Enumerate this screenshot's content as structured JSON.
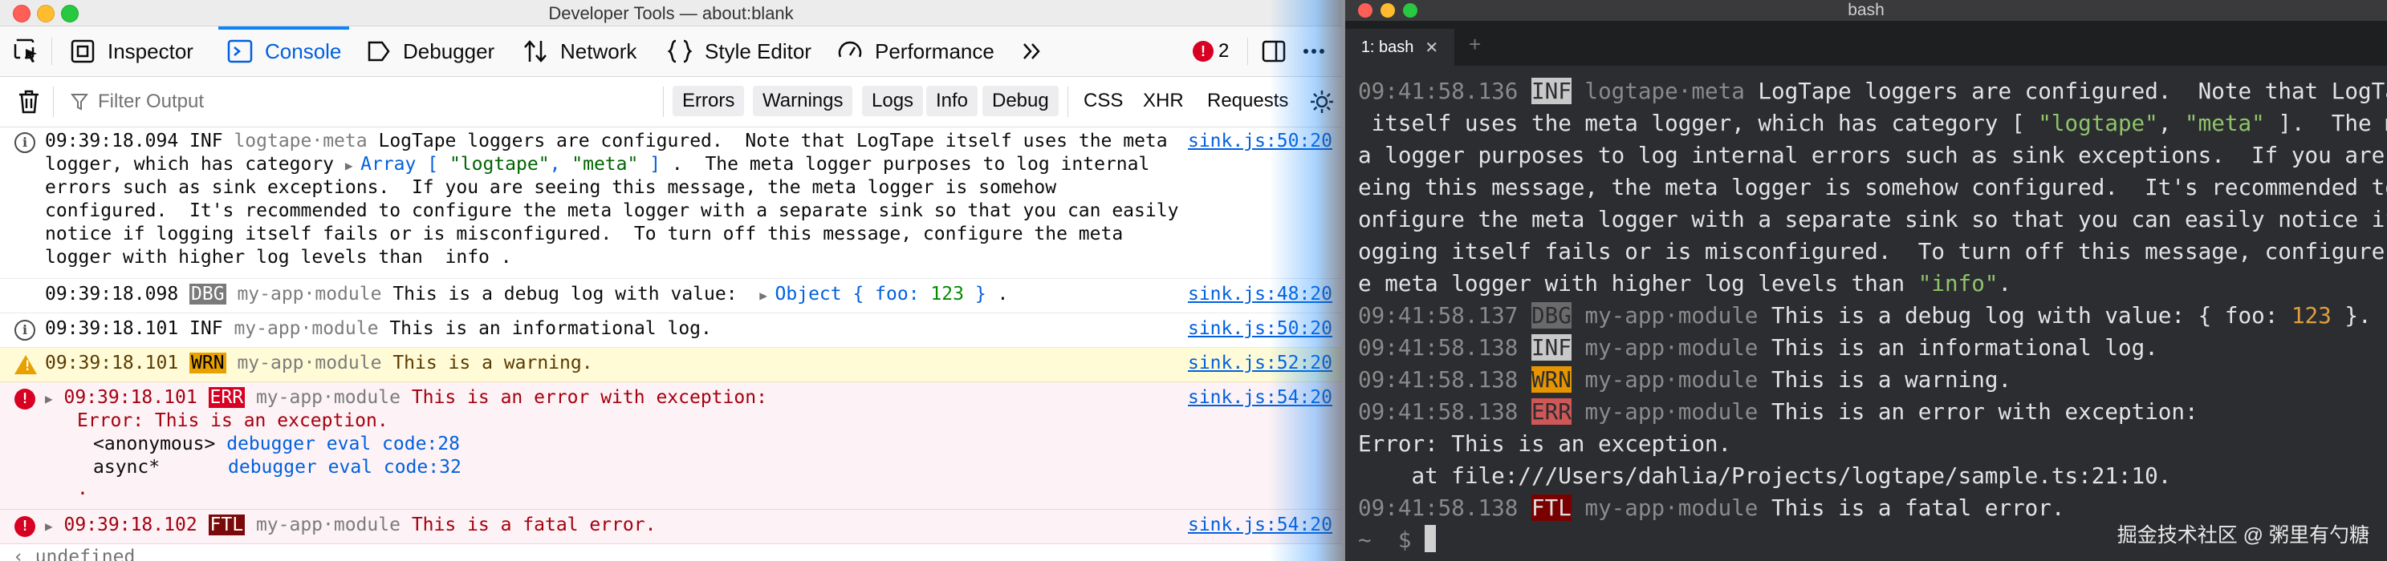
{
  "devtools": {
    "window_title": "Developer Tools — about:blank",
    "tabs": [
      "Inspector",
      "Console",
      "Debugger",
      "Network",
      "Style Editor",
      "Performance"
    ],
    "error_count": "2",
    "filter_placeholder": "Filter Output",
    "filter_buttons": [
      "Errors",
      "Warnings",
      "Logs",
      "Info",
      "Debug"
    ],
    "filter_toggles": [
      "CSS",
      "XHR",
      "Requests"
    ],
    "logs": [
      {
        "timestamp": "09:39:18.094",
        "level": "INF",
        "category": "logtape·meta",
        "line1_a": "LogTape loggers are configured.  Note that LogTape itself uses the meta",
        "line2_a": "logger, which has category ",
        "array_label": "Array [",
        "array_v1": "\"logtape\"",
        "array_sep": ", ",
        "array_v2": "\"meta\"",
        "array_end": " ]",
        "line2_b": " .  The meta logger purposes to log internal",
        "line3": "errors such as sink exceptions.  If you are seeing this message, the meta logger is somehow",
        "line4": "configured.  It's recommended to configure the meta logger with a separate sink so that you can easily",
        "line5": "notice if logging itself fails or is misconfigured.  To turn off this message, configure the meta",
        "line6": "logger with higher log levels than  info .",
        "source": "sink.js:50:20"
      },
      {
        "timestamp": "09:39:18.098",
        "level": "DBG",
        "category": "my-app·module",
        "message": "This is a debug log with value:",
        "object_label": "Object {",
        "object_key": " foo: ",
        "object_value": "123",
        "object_end": " }",
        "trailing": " .",
        "source": "sink.js:48:20"
      },
      {
        "timestamp": "09:39:18.101",
        "level": "INF",
        "category": "my-app·module",
        "message": "This is an informational log.",
        "source": "sink.js:50:20"
      },
      {
        "timestamp": "09:39:18.101",
        "level": "WRN",
        "category": "my-app·module",
        "message": "This is a warning.",
        "source": "sink.js:52:20"
      },
      {
        "timestamp": "09:39:18.101",
        "level": "ERR",
        "category": "my-app·module",
        "message": "This is an error with exception:",
        "exception": "Error: This is an exception.",
        "stack": [
          {
            "fn": "<anonymous>",
            "loc": "debugger eval code:28"
          },
          {
            "fn": "async*",
            "loc": "debugger eval code:32"
          }
        ],
        "stack_end": ".",
        "source": "sink.js:54:20"
      },
      {
        "timestamp": "09:39:18.102",
        "level": "FTL",
        "category": "my-app·module",
        "message": "This is a fatal error.",
        "source": "sink.js:54:20"
      }
    ],
    "last_line": "undefined"
  },
  "terminal": {
    "window_title": "bash",
    "tab_label": "1: bash",
    "lines": {
      "l1_ts": "09:41:58.136",
      "l1_lvl": "INF",
      "l1_cat": "logtape·meta",
      "l1_msg": " LogTape loggers are configured.  Note that LogTape",
      "l2_a": " itself uses the meta logger, which has category [ ",
      "l2_s1": "\"logtape\"",
      "l2_b": ", ",
      "l2_s2": "\"meta\"",
      "l2_c": " ].  The met",
      "l3": "a logger purposes to log internal errors such as sink exceptions.  If you are se",
      "l4": "eing this message, the meta logger is somehow configured.  It's recommended to c",
      "l5": "onfigure the meta logger with a separate sink so that you can easily notice if l",
      "l6": "ogging itself fails or is misconfigured.  To turn off this message, configure th",
      "l7_a": "e meta logger with higher log levels than ",
      "l7_s": "\"info\"",
      "l7_b": ".",
      "dbg_ts": "09:41:58.137",
      "dbg_lvl": "DBG",
      "dbg_cat": "my-app·module",
      "dbg_msg": " This is a debug log with value: { foo: ",
      "dbg_num": "123",
      "dbg_end": " }.",
      "inf_ts": "09:41:58.138",
      "inf_lvl": "INF",
      "inf_cat": "my-app·module",
      "inf_msg": " This is an informational log.",
      "wrn_ts": "09:41:58.138",
      "wrn_lvl": "WRN",
      "wrn_cat": "my-app·module",
      "wrn_msg": " This is a warning.",
      "err_ts": "09:41:58.138",
      "err_lvl": "ERR",
      "err_cat": "my-app·module",
      "err_msg": " This is an error with exception:",
      "exc1": "Error: This is an exception.",
      "exc2": "    at file:///Users/dahlia/Projects/logtape/sample.ts:21:10.",
      "ftl_ts": "09:41:58.138",
      "ftl_lvl": "FTL",
      "ftl_cat": "my-app·module",
      "ftl_msg": " This is a fatal error.",
      "prompt": "~  $ "
    },
    "watermark": "掘金技术社区 @ 粥里有勺糖"
  },
  "colors": {
    "devtools_accent": "#0a84ff",
    "warn_bg": "#fffbd6",
    "error_bg": "#fdf2f5",
    "terminal_bg": "#2b2d30"
  },
  "icons": [
    "pick-element-icon",
    "inspector-icon",
    "console-icon",
    "debugger-icon",
    "network-icon",
    "style-editor-icon",
    "performance-icon",
    "overflow-chevron-icon",
    "error-icon",
    "dock-icon",
    "more-icon",
    "trash-icon",
    "filter-icon",
    "settings-icon",
    "info-icon",
    "warning-icon"
  ]
}
